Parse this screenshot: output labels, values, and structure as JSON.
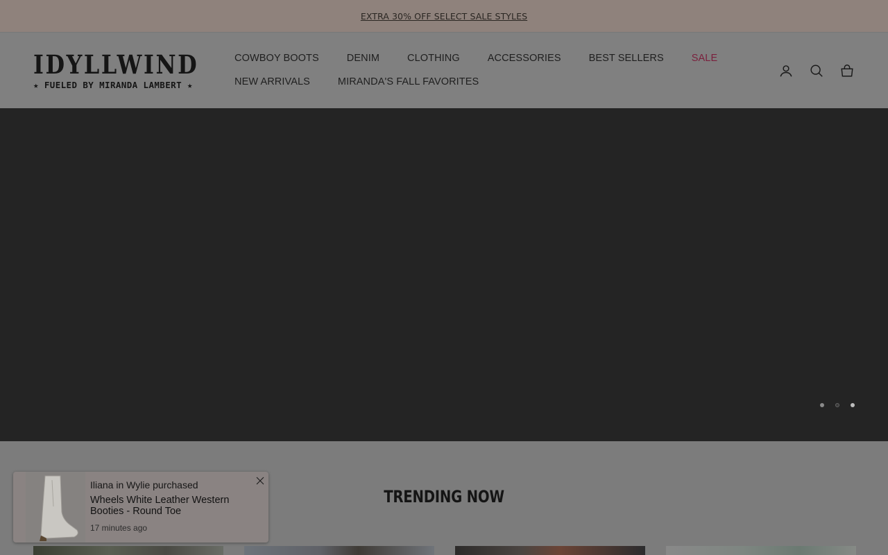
{
  "announcement": {
    "text": "EXTRA 30% OFF SELECT SALE STYLES"
  },
  "brand": {
    "logo_main": "IDYLLWIND",
    "logo_sub": "★ FUELED BY MIRANDA LAMBERT ★"
  },
  "nav": {
    "row1": [
      "COWBOY BOOTS",
      "DENIM",
      "CLOTHING",
      "ACCESSORIES",
      "BEST SELLERS",
      "SALE"
    ],
    "row2": [
      "NEW ARRIVALS",
      "MIRANDA'S FALL FAVORITES"
    ]
  },
  "header_icons": [
    "account-icon",
    "search-icon",
    "cart-icon"
  ],
  "carousel": {
    "slide_count": 3,
    "active_index": 1
  },
  "trending": {
    "title": "TRENDING NOW"
  },
  "purchase_popup": {
    "who": "Iliana in Wylie purchased",
    "product": "Wheels White Leather Western Booties - Round Toe",
    "time_ago": "17 minutes ago"
  },
  "colors": {
    "announcement_bg": "#8f827c",
    "header_bg": "#808080",
    "hero_bg": "#242424",
    "sale_accent": "#7a1f3c"
  }
}
